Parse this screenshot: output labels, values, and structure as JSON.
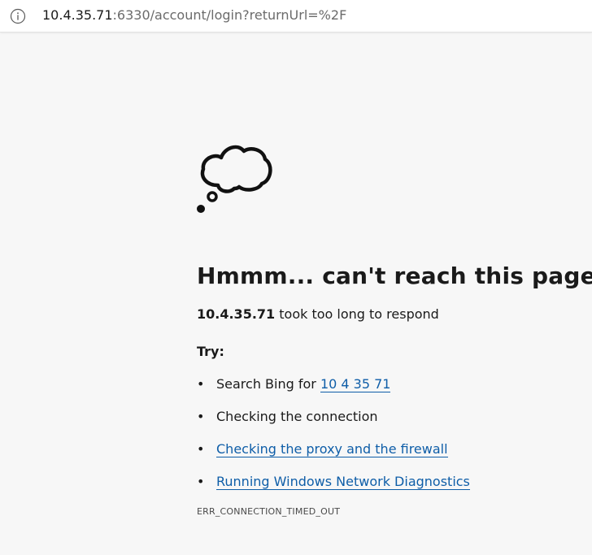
{
  "address_bar": {
    "info_icon": "info-circle-icon",
    "url_host": "10.4.35.71",
    "url_rest": ":6330/account/login?returnUrl=%2F"
  },
  "error_page": {
    "icon": "thought-cloud-icon",
    "title": "Hmmm... can't reach this page",
    "host": "10.4.35.71",
    "message": " took too long to respond",
    "try_label": "Try:",
    "suggestions": {
      "bing_prefix": "Search Bing for ",
      "bing_query": "10 4 35 71",
      "connection": "Checking the connection",
      "proxy": "Checking the proxy and the firewall",
      "diagnostics": "Running Windows Network Diagnostics"
    },
    "bullet": "•",
    "error_code": "ERR_CONNECTION_TIMED_OUT"
  },
  "colors": {
    "background": "#f7f7f7",
    "link": "#0f5ea8",
    "text": "#1a1a1a"
  }
}
